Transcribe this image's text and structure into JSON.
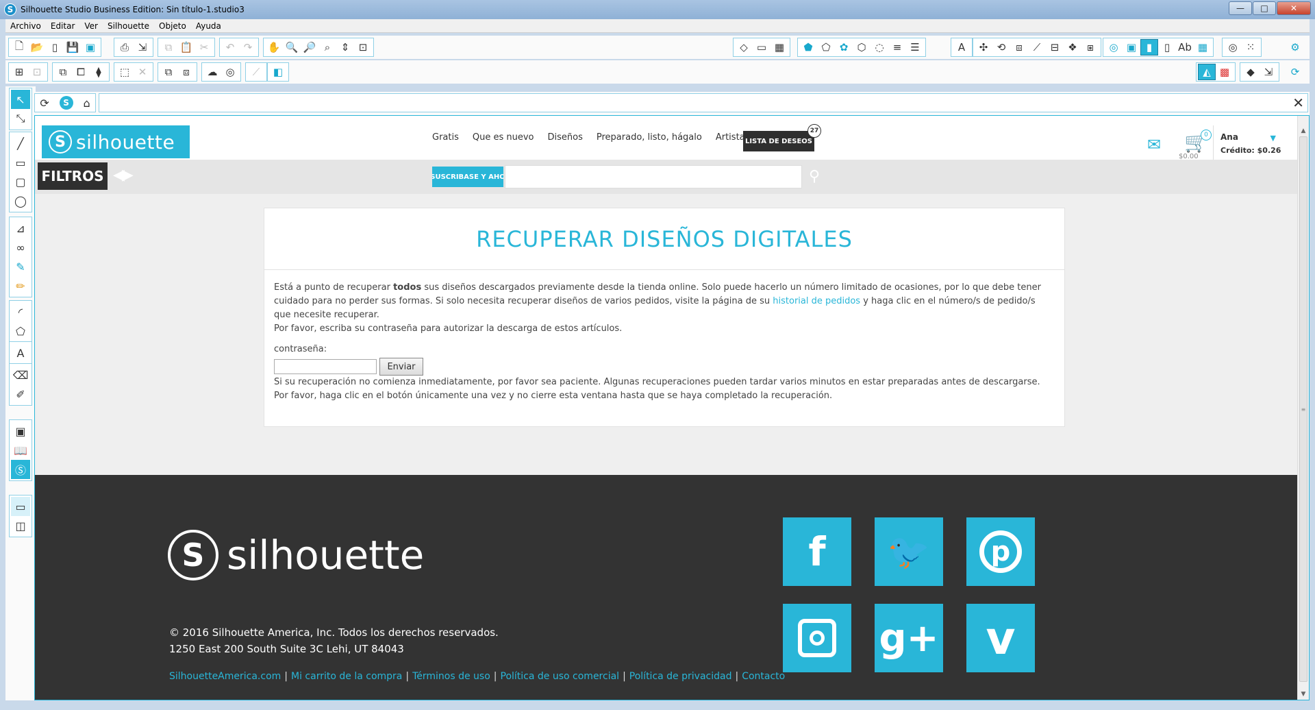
{
  "window": {
    "title": "Silhouette Studio Business Edition: Sin título-1.studio3",
    "min": "—",
    "max": "□",
    "close": "✕"
  },
  "menu": [
    "Archivo",
    "Editar",
    "Ver",
    "Silhouette",
    "Objeto",
    "Ayuda"
  ],
  "address": {
    "url": ""
  },
  "site": {
    "logo": "silhouette",
    "nav": [
      "Gratis",
      "Que es nuevo",
      "Diseños",
      "Preparado, listo, hágalo",
      "Artistas"
    ],
    "wishlist_label": "LISTA DE DESEOS",
    "wishlist_count": "27",
    "cart_count": "0",
    "cart_total": "$0.00",
    "user_name": "Ana",
    "user_credit": "Crédito: $0.26"
  },
  "filters": {
    "label": "FILTROS",
    "subscribe": "SUSCRIBASE Y AHO",
    "search_value": ""
  },
  "card": {
    "title": "RECUPERAR DISEÑOS DIGITALES",
    "p1_a": "Está a punto de recuperar ",
    "p1_bold": "todos",
    "p1_b": " sus diseños descargados previamente desde la tienda online. Solo puede hacerlo un número limitado de ocasiones, por lo que debe tener cuidado para no perder sus formas. Si solo necesita recuperar diseños de varios pedidos, visite la página de su ",
    "p1_link": "historial de pedidos",
    "p1_c": " y haga clic en el número/s de pedido/s que necesite recuperar.",
    "p2": "Por favor, escriba su contraseña para autorizar la descarga de estos artículos.",
    "pw_label": "contraseña:",
    "pw_value": "",
    "submit": "Enviar",
    "note1": "Si su recuperación no comienza inmediatamente, por favor sea paciente. Algunas recuperaciones pueden tardar varios minutos en estar preparadas antes de descargarse.",
    "note2": "Por favor, haga clic en el botón únicamente una vez y no cierre esta ventana hasta que se haya completado la recuperación."
  },
  "footer": {
    "logo": "silhouette",
    "copyright": "© 2016 Silhouette America, Inc. Todos los derechos reservados.",
    "address": "1250 East 200 South Suite 3C Lehi, UT 84043",
    "links": [
      "SilhouetteAmerica.com",
      "Mi carrito de la compra",
      "Términos de uso",
      "Política de uso comercial",
      "Política de privacidad",
      "Contacto"
    ],
    "social": [
      "facebook-icon",
      "twitter-icon",
      "pinterest-icon",
      "instagram-icon",
      "google-plus-icon",
      "vimeo-icon"
    ]
  },
  "colors": {
    "accent": "#29b6d8",
    "dark": "#333333"
  }
}
